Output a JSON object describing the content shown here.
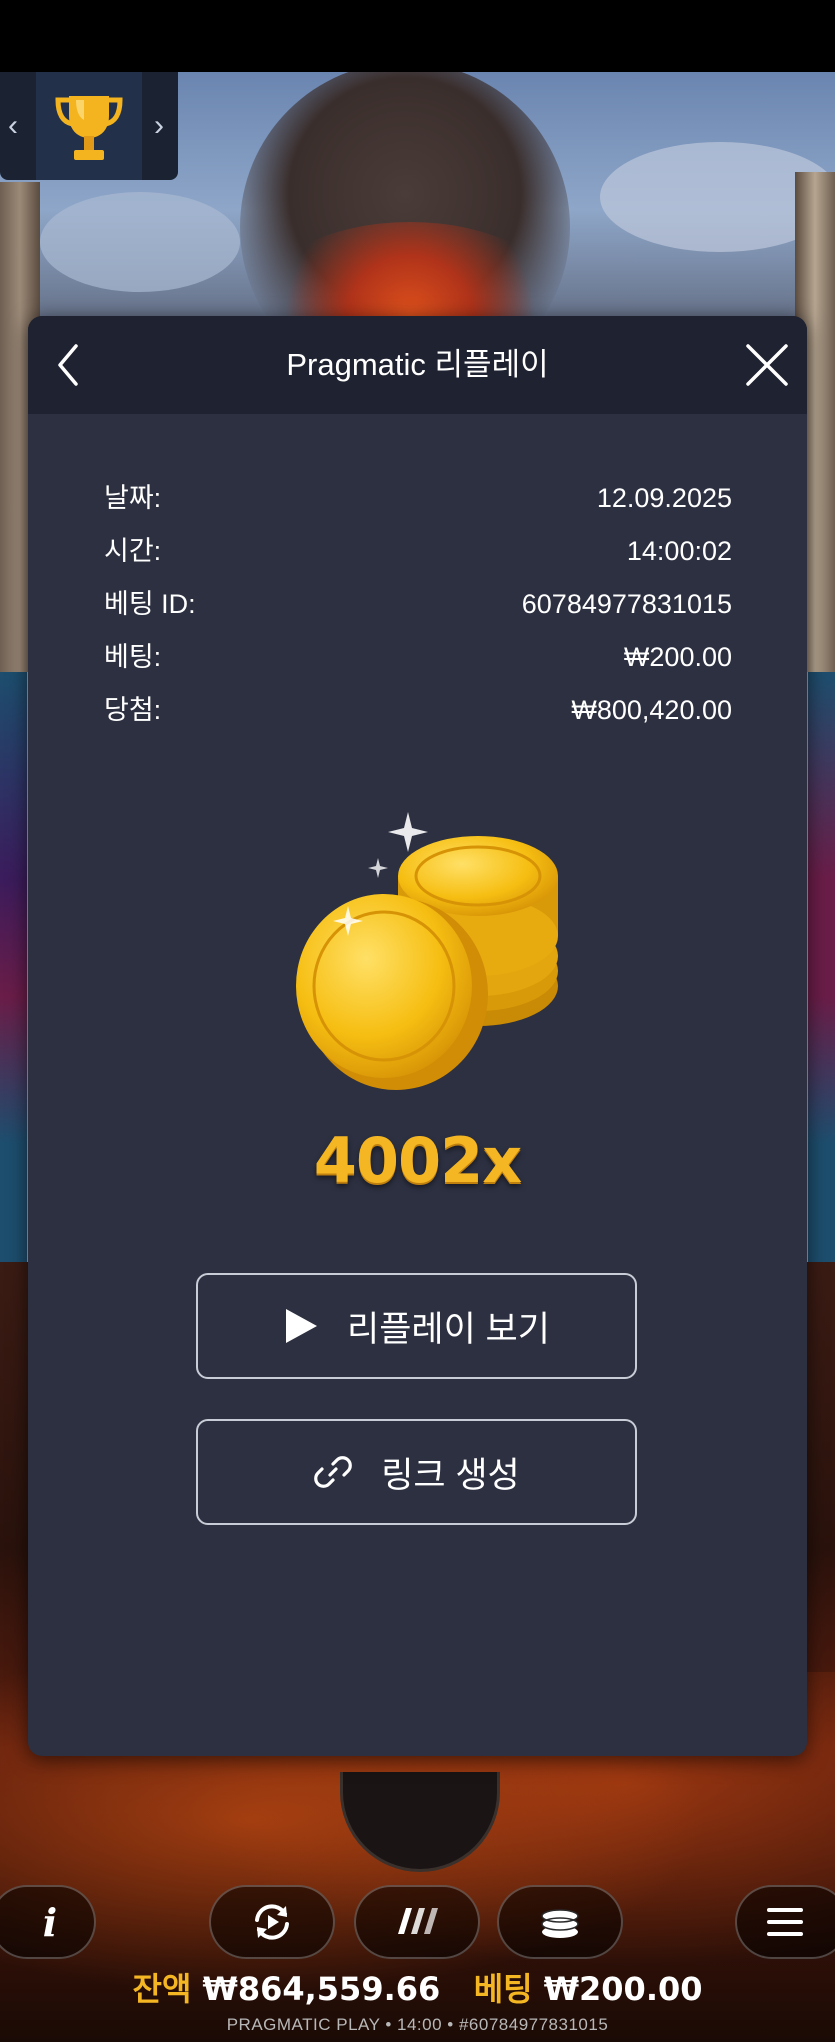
{
  "modal": {
    "title": "Pragmatic 리플레이",
    "details": [
      {
        "label": "날짜:",
        "value": "12.09.2025"
      },
      {
        "label": "시간:",
        "value": "14:00:02"
      },
      {
        "label": "베팅 ID:",
        "value": "60784977831015"
      },
      {
        "label": "베팅:",
        "value": "₩200.00"
      },
      {
        "label": "당첨:",
        "value": "₩800,420.00"
      }
    ],
    "multiplier": "4002x",
    "watch_replay_label": "리플레이 보기",
    "create_link_label": "링크 생성"
  },
  "bottom_bar": {
    "info_icon_glyph": "i",
    "balance_label": "잔액",
    "balance_value": "₩864,559.66",
    "bet_label": "베팅",
    "bet_value": "₩200.00",
    "footer": "PRAGMATIC PLAY • 14:00 • #60784977831015"
  },
  "icons": {
    "trophy": "trophy-icon",
    "back": "chevron-left-icon",
    "close": "close-icon",
    "play": "play-icon",
    "link": "link-icon",
    "autoplay": "autoplay-icon",
    "turbo": "turbo-icon",
    "coins": "coins-icon",
    "menu": "menu-icon"
  },
  "colors": {
    "modal_bg": "#2c3040",
    "header_bg": "#1f2230",
    "accent_gold": "#f5b624"
  }
}
